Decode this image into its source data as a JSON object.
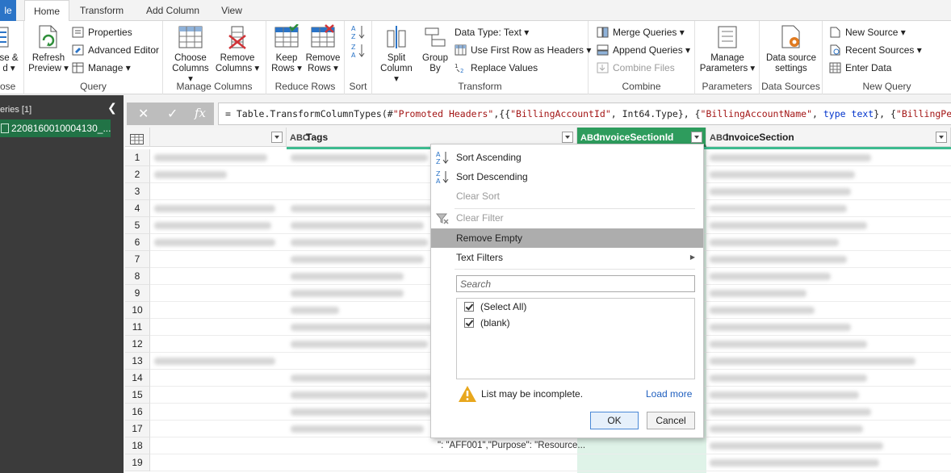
{
  "tabs": [
    {
      "label": "le",
      "key": "file"
    },
    {
      "label": "Home",
      "key": "home"
    },
    {
      "label": "Transform",
      "key": "transform"
    },
    {
      "label": "Add Column",
      "key": "addcolumn"
    },
    {
      "label": "View",
      "key": "view"
    }
  ],
  "ribbon": {
    "close": {
      "label_line1": "se &",
      "label_line2": "d ▾",
      "group": "ose"
    },
    "query": {
      "group": "Query",
      "refresh_line1": "Refresh",
      "refresh_line2": "Preview ▾",
      "properties": "Properties",
      "advanced_editor": "Advanced Editor",
      "manage": "Manage ▾"
    },
    "manage_columns": {
      "group": "Manage Columns",
      "choose_line1": "Choose",
      "choose_line2": "Columns ▾",
      "remove_line1": "Remove",
      "remove_line2": "Columns ▾"
    },
    "reduce_rows": {
      "group": "Reduce Rows",
      "keep_line1": "Keep",
      "keep_line2": "Rows ▾",
      "remove_line1": "Remove",
      "remove_line2": "Rows ▾"
    },
    "sort": {
      "group": "Sort"
    },
    "transform": {
      "group": "Transform",
      "split_line1": "Split",
      "split_line2": "Column ▾",
      "group_line1": "Group",
      "group_line2": "By",
      "data_type": "Data Type: Text ▾",
      "first_row": "Use First Row as Headers ▾",
      "replace": "Replace Values"
    },
    "combine": {
      "group": "Combine",
      "merge": "Merge Queries ▾",
      "append": "Append Queries ▾",
      "combine_files": "Combine Files"
    },
    "parameters": {
      "group": "Parameters",
      "line1": "Manage",
      "line2": "Parameters ▾"
    },
    "data_sources": {
      "group": "Data Sources",
      "line1": "Data source",
      "line2": "settings"
    },
    "new_query": {
      "group": "New Query",
      "new_source": "New Source ▾",
      "recent_sources": "Recent Sources ▾",
      "enter_data": "Enter Data"
    }
  },
  "queries_pane": {
    "header": "eries [1]",
    "item": "2208160010004130_..."
  },
  "formula_bar": {
    "cancel_icon": "✕",
    "commit_icon": "✓",
    "fx": "fx",
    "p1": "= Table.TransformColumnTypes(#",
    "s1": "\"Promoted Headers\"",
    "p2": ",{{",
    "s2": "\"BillingAccountId\"",
    "p3": ", Int64.Type}, {",
    "s3": "\"BillingAccountName\"",
    "p4": ", ",
    "k1": "type",
    "p5": " ",
    "k2": "text",
    "p6": "}, {",
    "s4": "\"BillingPeriodSta"
  },
  "grid": {
    "columns": [
      {
        "type": "",
        "name": ""
      },
      {
        "type": "ABC",
        "name": "Tags"
      },
      {
        "type": "ABC",
        "name": "InvoiceSectionId"
      },
      {
        "type": "ABC",
        "name": "InvoiceSection"
      }
    ],
    "rows": [
      "1",
      "2",
      "3",
      "4",
      "5",
      "6",
      "7",
      "8",
      "9",
      "10",
      "11",
      "12",
      "13",
      "14",
      "15",
      "16",
      "17",
      "18",
      "19"
    ],
    "row18_tags_visible": "\": \"AFF001\",\"Purpose\": \"Resource..."
  },
  "filter_menu": {
    "sort_ascending": "Sort Ascending",
    "sort_descending": "Sort Descending",
    "clear_sort": "Clear Sort",
    "clear_filter": "Clear Filter",
    "remove_empty": "Remove Empty",
    "text_filters": "Text Filters",
    "search_placeholder": "Search",
    "values": [
      "(Select All)",
      "(blank)"
    ],
    "warning": "List may be incomplete.",
    "load_more": "Load more",
    "ok": "OK",
    "cancel": "Cancel"
  },
  "colors": {
    "file_tab": "#2b74c7",
    "accent_green": "#217346",
    "selected_header": "#2e9c5d",
    "selected_column": "#dff3e8",
    "quality_bar": "#3dbb8f",
    "link": "#1f5fbf"
  }
}
